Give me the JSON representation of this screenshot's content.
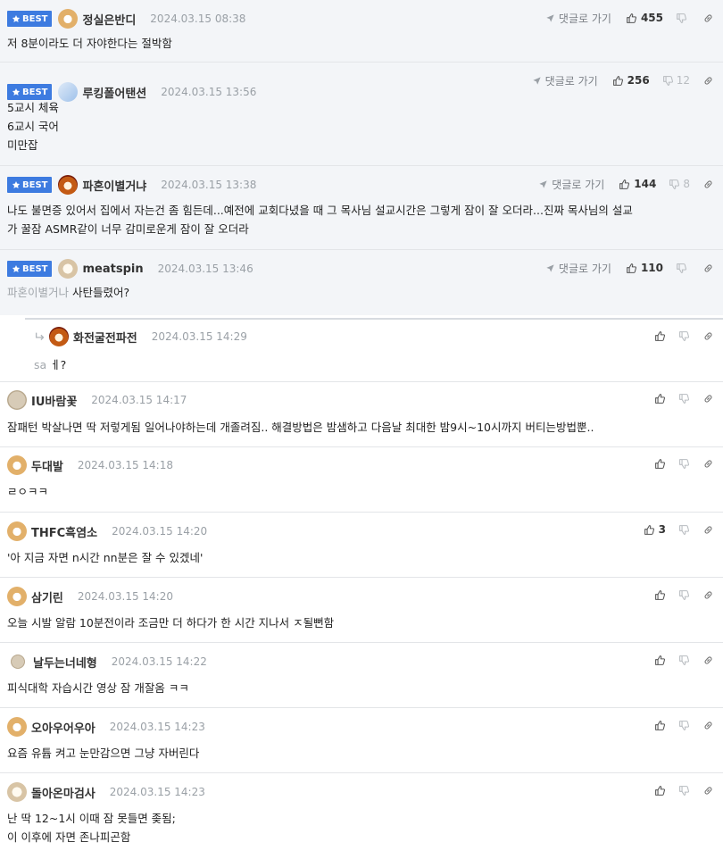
{
  "best_label": "BEST",
  "reply_link_label": "댓글로 가기",
  "comments": [
    {
      "nick": "정실은반디",
      "date": "2024.03.15 08:38",
      "up": "455",
      "down": "",
      "lines": [
        "저 8분이라도 더 자야한다는 절박함"
      ]
    },
    {
      "nick": "루킹폴어탠션",
      "date": "2024.03.15 13:56",
      "up": "256",
      "down": "12",
      "lines": [
        "5교시 체육",
        "6교시 국어",
        "미만잡"
      ]
    },
    {
      "nick": "파혼이별거냐",
      "date": "2024.03.15 13:38",
      "up": "144",
      "down": "8",
      "lines": [
        "나도 불면증 있어서 집에서 자는건 좀 힘든데...예전에 교회다녔을 때 그 목사님 설교시간은 그렇게 잠이 잘 오더라...진짜 목사님의 설교",
        "가 꿀잠 ASMR같이 너무 감미로운게 잠이 잘 오더라"
      ]
    },
    {
      "nick": "meatspin",
      "date": "2024.03.15 13:46",
      "up": "110",
      "down": "",
      "quote": "파혼이별거나",
      "text": "사탄들렸어?"
    },
    {
      "nick": "화전굴전파전",
      "date": "2024.03.15 14:29",
      "quote": "sa",
      "text": "ㅔ?"
    },
    {
      "nick": "IU바람꽃",
      "date": "2024.03.15 14:17",
      "up": "",
      "lines": [
        "잠패턴 박살나면 딱 저렇게됨 일어나야하는데 개졸려짐.. 해결방법은 밤샘하고 다음날 최대한 밤9시~10시까지 버티는방법뿐.."
      ]
    },
    {
      "nick": "두대발",
      "date": "2024.03.15 14:18",
      "up": "",
      "lines": [
        "ㄹㅇㅋㅋ"
      ]
    },
    {
      "nick": "THFC흑염소",
      "date": "2024.03.15 14:20",
      "up": "3",
      "lines": [
        "'아 지금 자면 n시간 nn분은 잘 수 있겠네'"
      ]
    },
    {
      "nick": "삼기린",
      "date": "2024.03.15 14:20",
      "up": "",
      "lines": [
        "오늘 시발 알람 10분전이라 조금만 더 하다가 한 시간 지나서 ㅈ될뻔함"
      ]
    },
    {
      "nick": "날두는너네형",
      "date": "2024.03.15 14:22",
      "up": "",
      "lines": [
        "피식대학 자습시간 영상 잠 개잘옴 ㅋㅋ"
      ]
    },
    {
      "nick": "오아우어우아",
      "date": "2024.03.15 14:23",
      "up": "",
      "lines": [
        "요즘 유튭 켜고 눈만감으면 그냥 자버린다"
      ]
    },
    {
      "nick": "돌아온마검사",
      "date": "2024.03.15 14:23",
      "up": "",
      "lines": [
        "난 딱 12~1시 이때 잠 못들면 좆됨;",
        "이 이후에 자면 존나피곤함"
      ]
    }
  ]
}
